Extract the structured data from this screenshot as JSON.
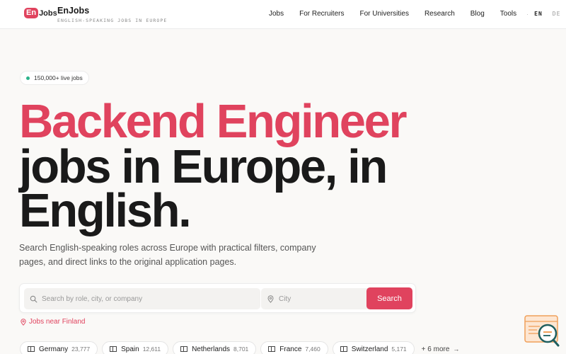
{
  "header": {
    "logo_en": "En",
    "logo_jobs": "Jobs",
    "brand_name": "EnJobs",
    "tagline": "ENGLISH-SPEAKING JOBS IN EUROPE",
    "nav": [
      "Jobs",
      "For Recruiters",
      "For Universities",
      "Research",
      "Blog",
      "Tools"
    ],
    "separator": "·",
    "lang_en": "EN",
    "lang_de": "DE"
  },
  "badge": {
    "text": "150,000+ live jobs",
    "dot_color": "#2bb38a"
  },
  "hero": {
    "line1": "Backend Engineer",
    "line2": "jobs in Europe, in",
    "line3": "English.",
    "accent_color": "#e0435e"
  },
  "subtitle": "Search English-speaking roles across Europe with practical filters, company pages, and direct links to the original application pages.",
  "search": {
    "query_placeholder": "Search by role, city, or company",
    "city_placeholder": "City",
    "button_label": "Search",
    "search_icon": "search-icon",
    "pin_icon": "map-pin-icon"
  },
  "near_link": "Jobs near Finland",
  "countries": [
    {
      "name": "Germany",
      "count": "23,777"
    },
    {
      "name": "Spain",
      "count": "12,611"
    },
    {
      "name": "Netherlands",
      "count": "8,701"
    },
    {
      "name": "France",
      "count": "7,460"
    },
    {
      "name": "Switzerland",
      "count": "5,171"
    }
  ],
  "more_countries": "+ 6 more",
  "more_arrow": "→"
}
